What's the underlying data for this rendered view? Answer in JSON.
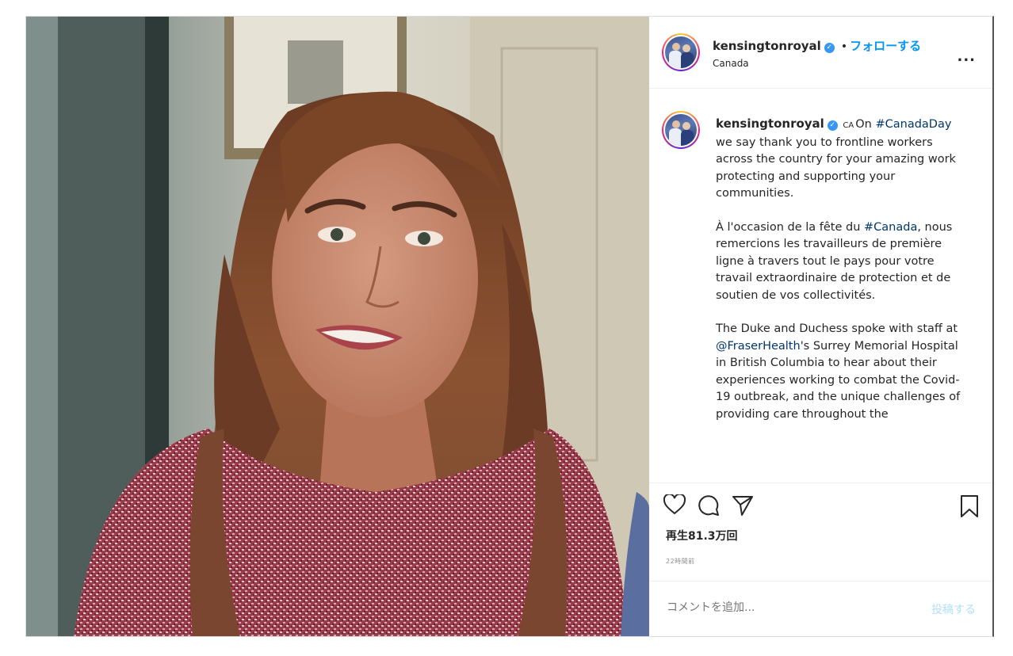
{
  "header": {
    "username": "kensingtonroyal",
    "separator": "•",
    "follow_label": "フォローする",
    "location": "Canada",
    "more_label": "..."
  },
  "caption": {
    "username": "kensingtonroyal",
    "flag": "CA",
    "p1_start": "On ",
    "p1_tag": "#CanadaDay",
    "p1_rest": " we say thank you to frontline workers across the country for your amazing work protecting and supporting your communities.",
    "p2_start": "À l'occasion de la fête du ",
    "p2_tag": "#Canada",
    "p2_rest": ", nous remercions les travailleurs de première ligne à travers tout le pays pour votre travail extraordinaire de protection et de soutien de vos collectivités.",
    "p3_start": "The Duke and Duchess spoke with staff at ",
    "p3_tag": "@FraserHealth",
    "p3_rest": "'s Surrey Memorial Hospital in British Columbia to hear about their experiences working to combat the Covid-19 outbreak, and the unique challenges of providing care throughout the"
  },
  "icons": {
    "like": "heart-icon",
    "comment": "comment-icon",
    "share": "paper-plane-icon",
    "save": "bookmark-icon",
    "verified": "verified-badge-icon"
  },
  "stats": {
    "views": "再生81.3万回",
    "time": "22時間前"
  },
  "comment_box": {
    "placeholder": "コメントを追加...",
    "post_label": "投稿する"
  },
  "colors": {
    "link": "#0095f6",
    "hashtag": "#00376b",
    "post_disabled": "#b2dffc"
  }
}
